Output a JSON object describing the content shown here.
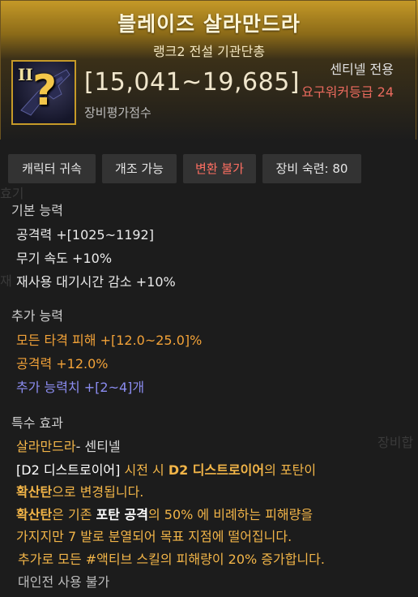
{
  "item": {
    "name": "블레이즈 살라만드라",
    "subtitle": "랭크2 전설 기관단총",
    "grade_roman": "II",
    "score": "[15,041~19,685]",
    "score_label": "장비평가점수",
    "class_requirement": "센티넬 전용",
    "level_requirement": "요구워커등급 24",
    "icon": "question-mark-icon"
  },
  "tags": [
    {
      "label": "캐릭터 귀속"
    },
    {
      "label": "개조 가능"
    },
    {
      "label": "변환 불가"
    },
    {
      "label": "장비 숙련: 80"
    }
  ],
  "basic": {
    "title": "기본 능력",
    "lines": [
      "공격력  +[1025~1192]",
      "무기 속도 +10%",
      "재사용 대기시간 감소 +10%"
    ]
  },
  "additional": {
    "title": "추가 능력",
    "lines": [
      "모든 타격 피해  +[12.0~25.0]%",
      "공격력  +12.0%",
      "추가 능력치 +[2~4]개"
    ]
  },
  "special": {
    "title": "특수 효과",
    "name": "살라만드라",
    "name_suffix": "- 센티넬",
    "l1_a": "[D2 디스트로이어]",
    "l1_b": " 시전 시 ",
    "l1_c": "D2 디스트로이어",
    "l1_d": "의 포탄이",
    "l2_a": "확산탄",
    "l2_b": "으로 변경됩니다.",
    "l3_a": "확산탄",
    "l3_b": "은 기존 ",
    "l3_c": "포탄 공격",
    "l3_d": "의 50% 에 비례하는 피해량을",
    "l4": "가지지만 7 발로 분열되어 목표 지점에 떨어집니다.",
    "l5": "추가로 모든 #액티브 스킬의 피해량이 20% 증가합니다.",
    "l6": "대인전 사용 불가"
  },
  "ghost": {
    "left_top": "효기",
    "right_mid": "장비합",
    "left_mid": "재"
  },
  "colors": {
    "header_gold": "#c69a28",
    "requirement_red": "#ea6a5e",
    "option_orange": "#f2a238",
    "option_blue": "#8b8cf0"
  }
}
